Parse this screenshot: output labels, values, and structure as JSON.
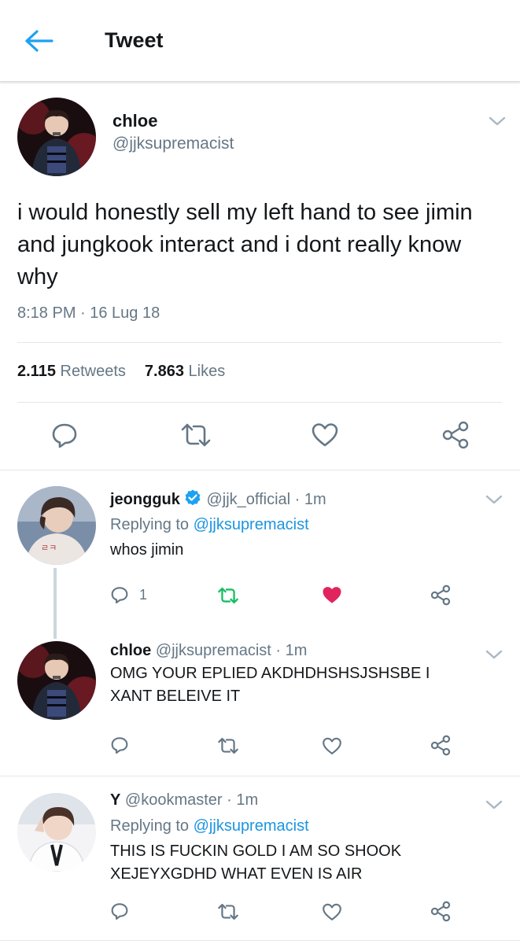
{
  "header": {
    "title": "Tweet"
  },
  "tweet": {
    "name": "chloe",
    "handle": "@jjksupremacist",
    "text": "i would honestly sell my left hand to see jimin and jungkook interact and i dont really know why",
    "timestamp": "8:18 PM · 16 Lug 18",
    "retweets_count": "2.115",
    "retweets_label": "Retweets",
    "likes_count": "7.863",
    "likes_label": "Likes"
  },
  "replies": [
    {
      "name": "jeongguk",
      "verified": true,
      "handle": "@jjk_official · 1m",
      "replying_prefix": "Replying to ",
      "replying_to": "@jjksupremacist",
      "text": "whos jimin",
      "reply_count": "1",
      "retweeted": true,
      "liked": true
    },
    {
      "name": "chloe",
      "handle": "@jjksupremacist · 1m",
      "text": "OMG YOUR EPLIED AKDHDHSHSJSHSBE I XANT BELEIVE IT"
    },
    {
      "name": "Y",
      "handle": "@kookmaster · 1m",
      "replying_prefix": "Replying to ",
      "replying_to": "@jjksupremacist",
      "text": "THIS IS FUCKIN GOLD I AM SO SHOOK XEJEYXGDHD WHAT EVEN IS AIR"
    }
  ],
  "colors": {
    "accent": "#1da1f2",
    "link": "#1b95e0",
    "retweet_active": "#17bf63",
    "like_active": "#e0245e",
    "muted": "#657786"
  },
  "icons": [
    "back-arrow-icon",
    "chevron-down-icon",
    "reply-icon",
    "retweet-icon",
    "heart-icon",
    "share-icon",
    "verified-badge-icon"
  ]
}
